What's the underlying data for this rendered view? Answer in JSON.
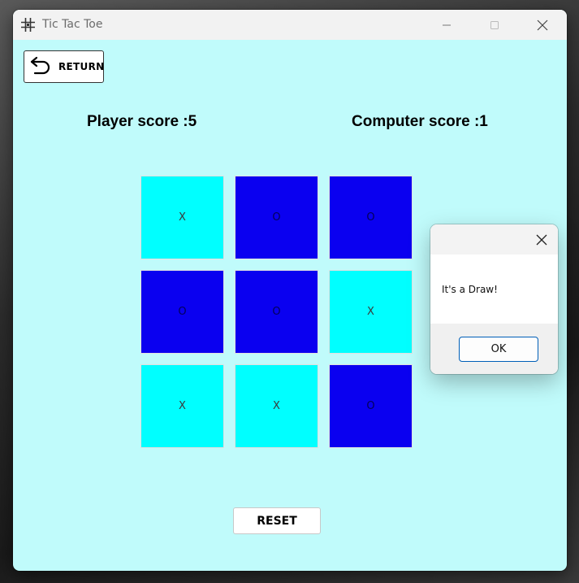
{
  "window": {
    "title": "Tic Tac Toe",
    "app_icon": "tic-tac-toe-grid-icon",
    "background_color": "#c0fbfb"
  },
  "toolbar": {
    "return_label": "RETURN",
    "return_icon": "undo-arrow-icon"
  },
  "scores": {
    "player": "Player score :5",
    "computer": "Computer score :1"
  },
  "board": {
    "cells": [
      {
        "mark": "X",
        "color": "#00ffff"
      },
      {
        "mark": "O",
        "color": "#0a00f0"
      },
      {
        "mark": "O",
        "color": "#0a00f0"
      },
      {
        "mark": "O",
        "color": "#0a00f0"
      },
      {
        "mark": "O",
        "color": "#0a00f0"
      },
      {
        "mark": "X",
        "color": "#00ffff"
      },
      {
        "mark": "X",
        "color": "#00ffff"
      },
      {
        "mark": "X",
        "color": "#00ffff"
      },
      {
        "mark": "O",
        "color": "#0a00f0"
      }
    ]
  },
  "reset_label": "RESET",
  "dialog": {
    "message": "It's a Draw!",
    "ok_label": "OK"
  }
}
